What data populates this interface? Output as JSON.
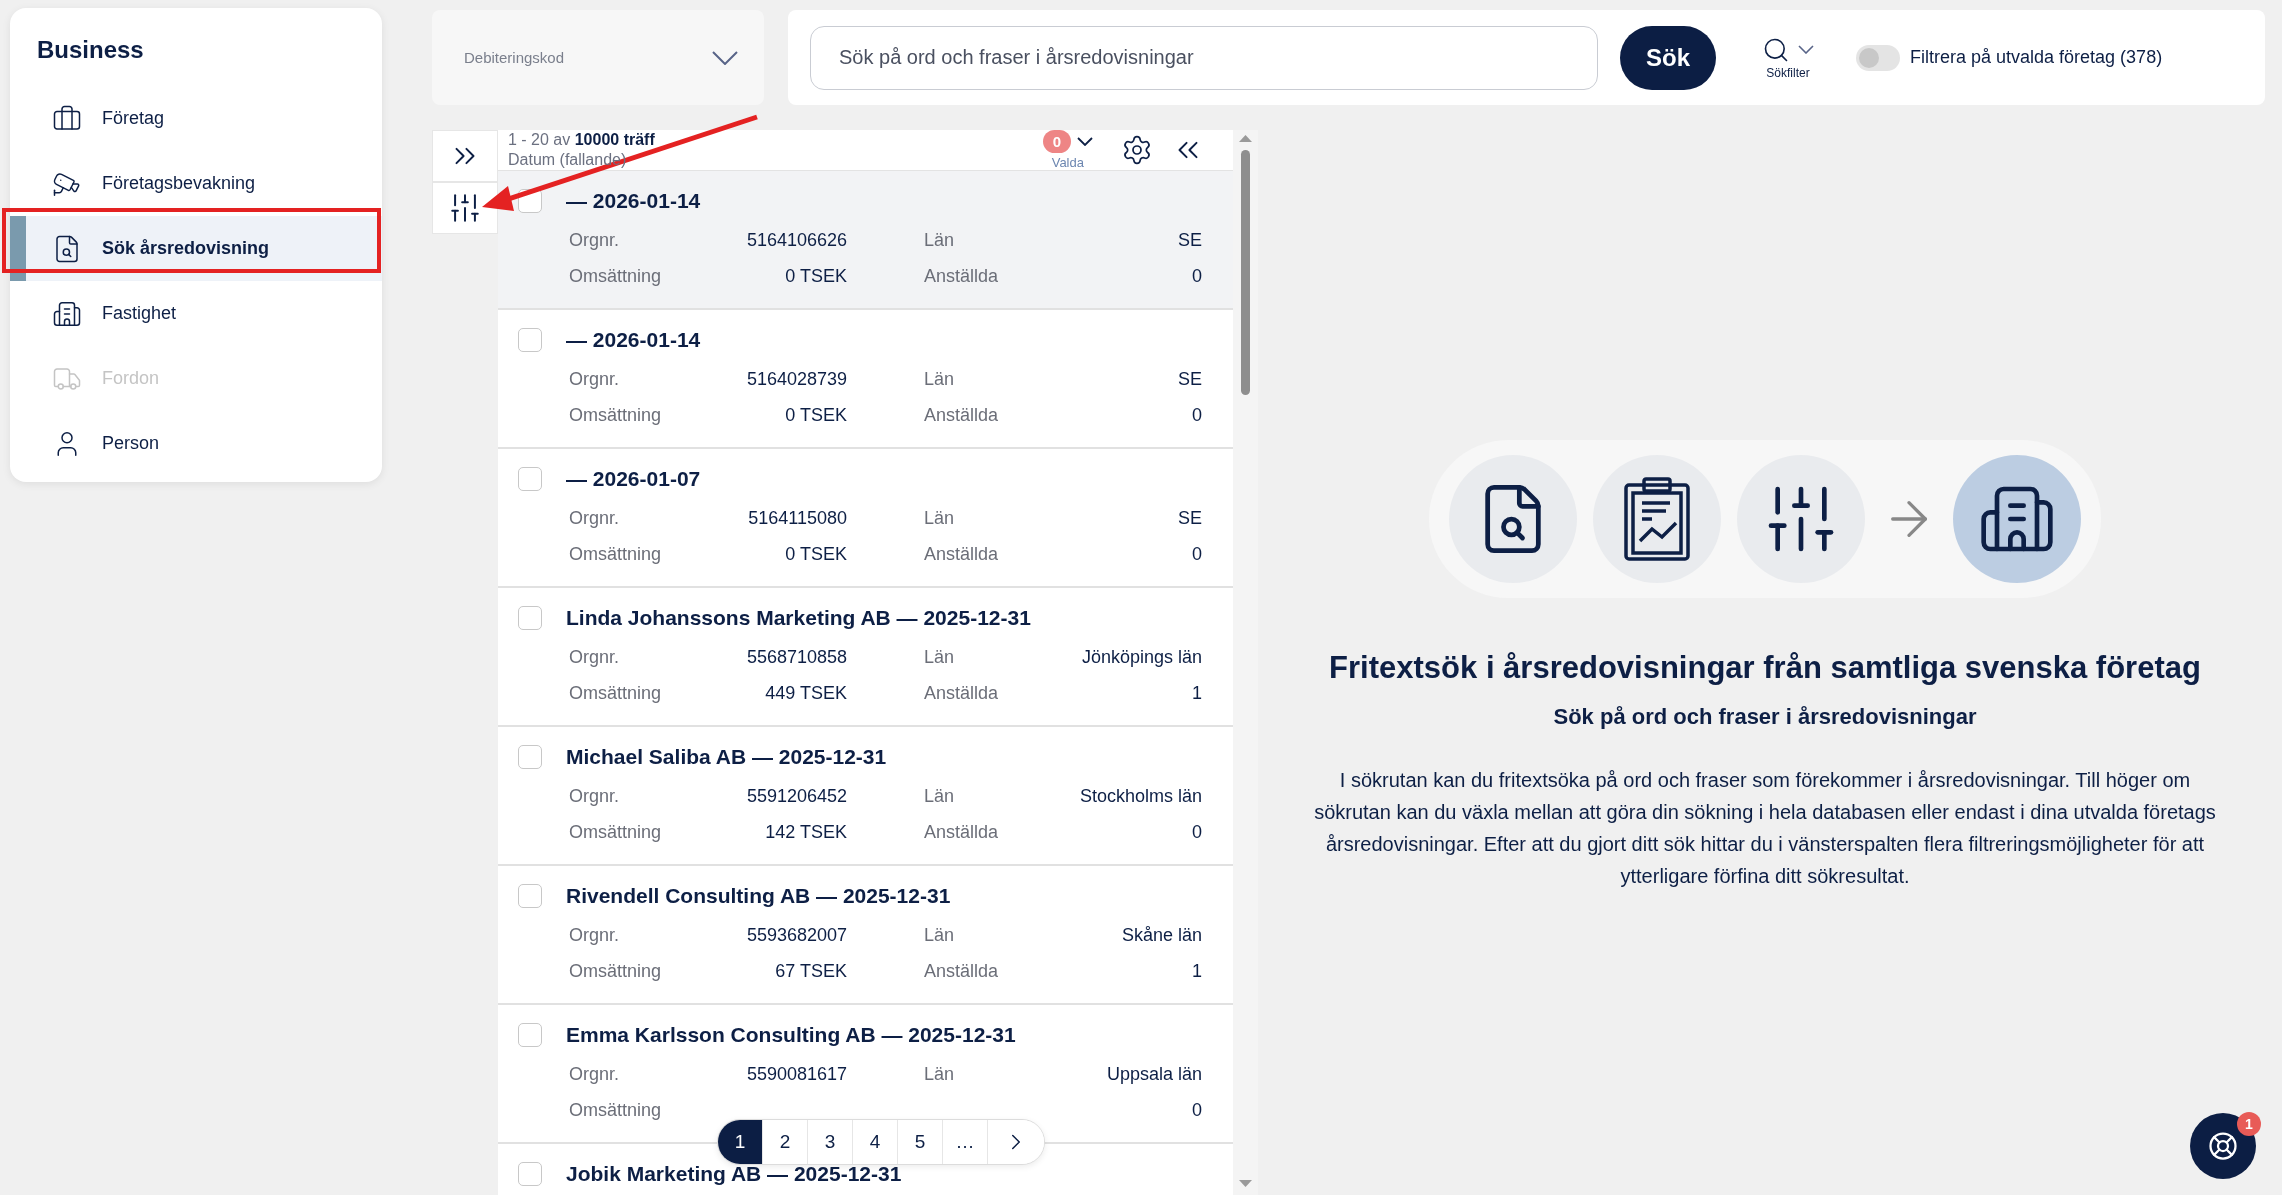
{
  "sidebar": {
    "title": "Business",
    "items": [
      {
        "label": "Företag",
        "selected": false,
        "disabled": false
      },
      {
        "label": "Företagsbevakning",
        "selected": false,
        "disabled": false
      },
      {
        "label": "Sök årsredovisning",
        "selected": true,
        "disabled": false
      },
      {
        "label": "Fastighet",
        "selected": false,
        "disabled": false
      },
      {
        "label": "Fordon",
        "selected": false,
        "disabled": true
      },
      {
        "label": "Person",
        "selected": false,
        "disabled": false
      }
    ]
  },
  "billing_dropdown": {
    "placeholder": "Debiteringskod"
  },
  "search": {
    "placeholder": "Sök på ord och fraser i årsredovisningar",
    "button": "Sök",
    "filter_label": "Sökfilter",
    "toggle": {
      "label": "Filtrera på utvalda företag (378)",
      "on": false
    }
  },
  "results": {
    "range": "1 - 20 av",
    "total": "10000 träff",
    "sort": "Datum (fallande)",
    "selected_count": "0",
    "selected_label": "Valda",
    "rows": [
      {
        "title": "— 2026-01-14",
        "checked": false,
        "highlighted": true,
        "cells": [
          {
            "label": "Orgnr.",
            "value": "5164106626"
          },
          {
            "label": "Län",
            "value": "SE"
          },
          {
            "label": "Omsättning",
            "value": "0 TSEK"
          },
          {
            "label": "Anställda",
            "value": "0"
          }
        ]
      },
      {
        "title": "— 2026-01-14",
        "checked": false,
        "highlighted": false,
        "cells": [
          {
            "label": "Orgnr.",
            "value": "5164028739"
          },
          {
            "label": "Län",
            "value": "SE"
          },
          {
            "label": "Omsättning",
            "value": "0 TSEK"
          },
          {
            "label": "Anställda",
            "value": "0"
          }
        ]
      },
      {
        "title": "— 2026-01-07",
        "checked": false,
        "highlighted": false,
        "cells": [
          {
            "label": "Orgnr.",
            "value": "5164115080"
          },
          {
            "label": "Län",
            "value": "SE"
          },
          {
            "label": "Omsättning",
            "value": "0 TSEK"
          },
          {
            "label": "Anställda",
            "value": "0"
          }
        ]
      },
      {
        "title": "Linda Johanssons Marketing AB — 2025-12-31",
        "checked": false,
        "highlighted": false,
        "cells": [
          {
            "label": "Orgnr.",
            "value": "5568710858"
          },
          {
            "label": "Län",
            "value": "Jönköpings län"
          },
          {
            "label": "Omsättning",
            "value": "449 TSEK"
          },
          {
            "label": "Anställda",
            "value": "1"
          }
        ]
      },
      {
        "title": "Michael Saliba AB — 2025-12-31",
        "checked": false,
        "highlighted": false,
        "cells": [
          {
            "label": "Orgnr.",
            "value": "5591206452"
          },
          {
            "label": "Län",
            "value": "Stockholms län"
          },
          {
            "label": "Omsättning",
            "value": "142 TSEK"
          },
          {
            "label": "Anställda",
            "value": "0"
          }
        ]
      },
      {
        "title": "Rivendell Consulting AB — 2025-12-31",
        "checked": false,
        "highlighted": false,
        "cells": [
          {
            "label": "Orgnr.",
            "value": "5593682007"
          },
          {
            "label": "Län",
            "value": "Skåne län"
          },
          {
            "label": "Omsättning",
            "value": "67 TSEK"
          },
          {
            "label": "Anställda",
            "value": "1"
          }
        ]
      },
      {
        "title": "Emma Karlsson Consulting AB — 2025-12-31",
        "checked": false,
        "highlighted": false,
        "cells": [
          {
            "label": "Orgnr.",
            "value": "5590081617"
          },
          {
            "label": "Län",
            "value": "Uppsala län"
          },
          {
            "label": "Omsättning"
          },
          {
            "value": "0"
          }
        ]
      },
      {
        "title": "Jobik Marketing AB — 2025-12-31",
        "checked": false,
        "highlighted": false,
        "cells": []
      }
    ]
  },
  "pagination": [
    {
      "label": "1",
      "selected": true
    },
    {
      "label": "2",
      "selected": false
    },
    {
      "label": "3",
      "selected": false
    },
    {
      "label": "4",
      "selected": false
    },
    {
      "label": "5",
      "selected": false
    },
    {
      "label": "…",
      "selected": false
    }
  ],
  "hero": {
    "title": "Fritextsök i årsredovisningar från samtliga svenska företag",
    "subtitle": "Sök på ord och fraser i årsredovisningar",
    "text": "I sökrutan kan du fritextsöka på ord och fraser som förekommer i årsredovisningar. Till höger om sökrutan kan du växla mellan att göra din sökning i hela databasen eller endast i dina utvalda företags årsredovisningar. Efter att du gjort ditt sök hittar du i vänsterspalten flera filtreringsmöjligheter för att ytterligare förfina ditt sökresultat."
  },
  "chat": {
    "badge": "1"
  }
}
